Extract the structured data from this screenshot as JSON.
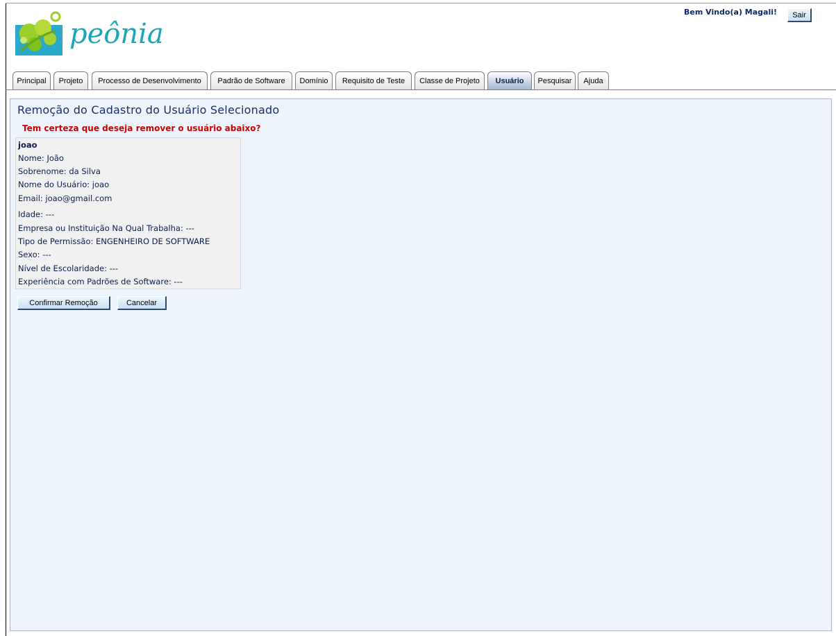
{
  "brand": {
    "name": "peônia",
    "logo_icon": "flower-logo-icon",
    "accent_color": "#1ea6b8"
  },
  "header": {
    "welcome": "Bem Vindo(a) Magali!",
    "logout_label": "Sair"
  },
  "tabs": [
    {
      "label": "Principal"
    },
    {
      "label": "Projeto"
    },
    {
      "label": "Processo de Desenvolvimento"
    },
    {
      "label": "Padrão de Software"
    },
    {
      "label": "Domínio"
    },
    {
      "label": "Requisito de Teste"
    },
    {
      "label": "Classe de Projeto"
    },
    {
      "label": "Usuário",
      "active": true
    },
    {
      "label": "Pesquisar"
    },
    {
      "label": "Ajuda"
    }
  ],
  "main": {
    "title": "Remoção do Cadastro do Usuário Selecionado",
    "question": "Tem certeza que deseja remover o usuário abaixo?",
    "user": {
      "username": "joao",
      "lines": [
        "Nome: João",
        "Sobrenome: da Silva",
        "Nome do Usuário: joao",
        "Email: joao@gmail.com",
        "Idade: ---",
        "Empresa ou Instituição Na Qual Trabalha: ---",
        "Tipo de Permissão: ENGENHEIRO DE SOFTWARE",
        "Sexo: ---",
        "Nível de Escolaridade: ---",
        "Experiência com Padrões de Software: ---"
      ]
    },
    "confirm_label": "Confirmar Remoção",
    "cancel_label": "Cancelar"
  }
}
